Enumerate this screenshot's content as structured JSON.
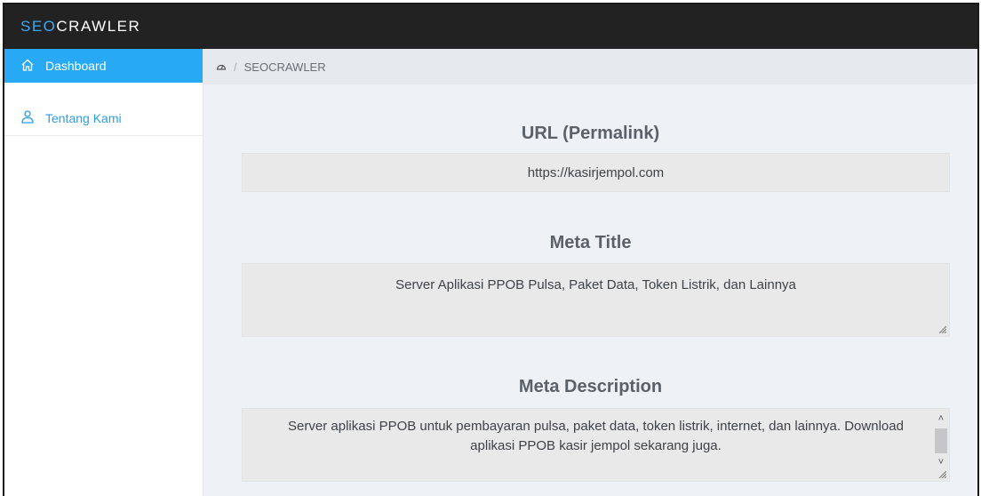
{
  "app": {
    "brand_accent": "SEO",
    "brand_rest": "CRAWLER",
    "accent_color": "#3aaaf7"
  },
  "sidebar": {
    "items": [
      {
        "label": "Dashboard",
        "icon": "home-icon",
        "active": true
      },
      {
        "label": "Tentang Kami",
        "icon": "user-icon",
        "active": false
      }
    ]
  },
  "breadcrumb": {
    "icon": "dashboard-icon",
    "current": "SEOCRAWLER"
  },
  "sections": {
    "url": {
      "title": "URL (Permalink)",
      "value": "https://kasirjempol.com"
    },
    "meta_title": {
      "title": "Meta Title",
      "value": "Server Aplikasi PPOB Pulsa, Paket Data, Token Listrik, dan Lainnya"
    },
    "meta_description": {
      "title": "Meta Description",
      "value": "Server aplikasi PPOB untuk pembayaran pulsa, paket data, token listrik, internet, dan lainnya. Download aplikasi PPOB kasir jempol sekarang juga."
    }
  }
}
